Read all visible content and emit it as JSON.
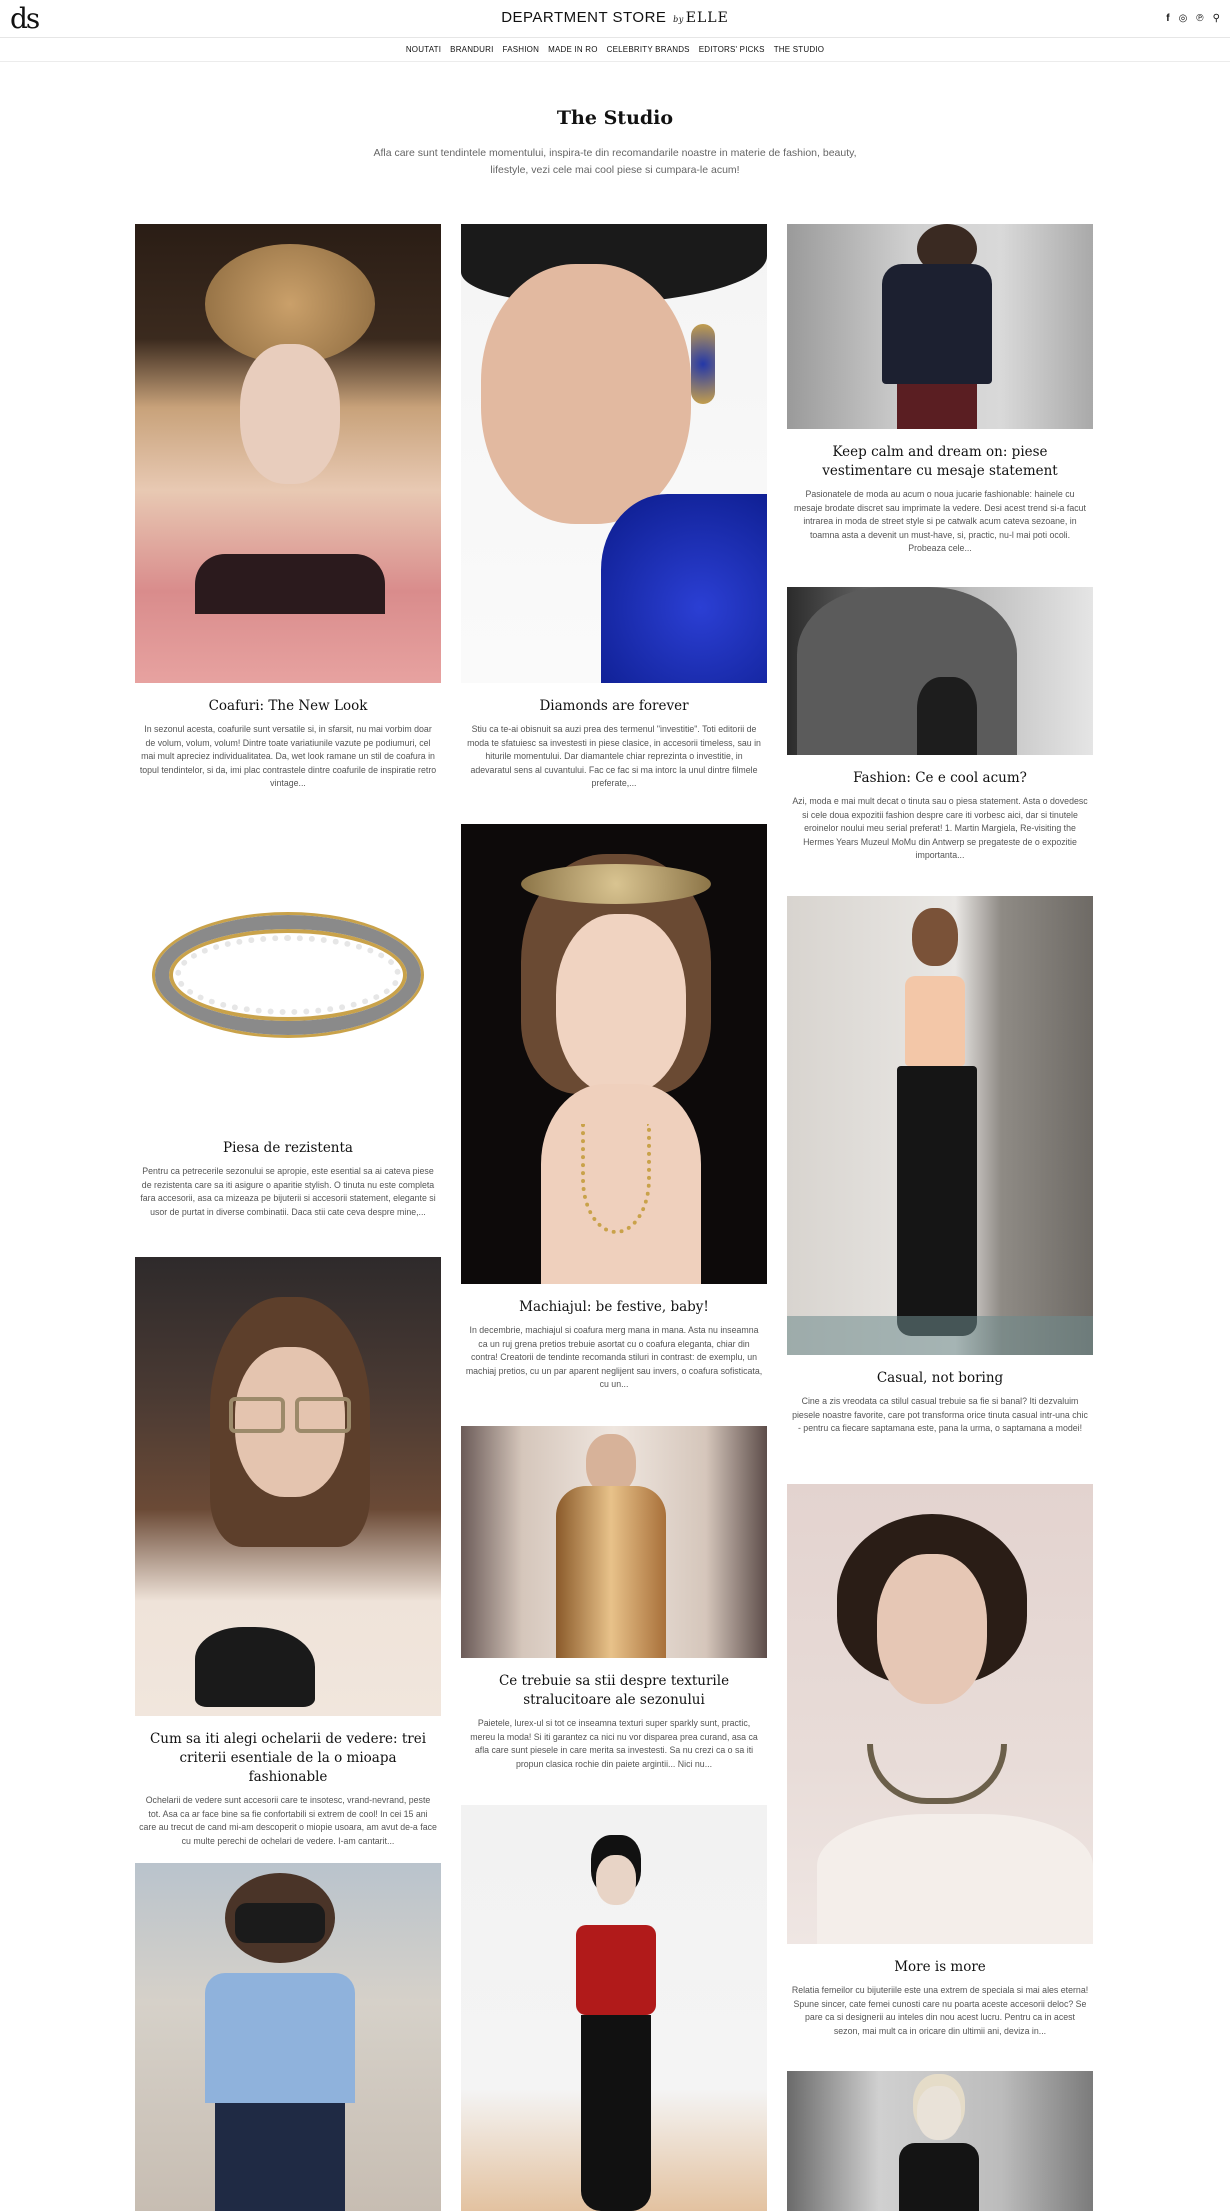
{
  "header": {
    "logo": "ds",
    "brand_name": "DEPARTMENT STORE",
    "brand_by": "by",
    "brand_elle": "ELLE",
    "social": [
      {
        "icon": "facebook-icon",
        "glyph": "f"
      },
      {
        "icon": "instagram-icon",
        "glyph": "◎"
      },
      {
        "icon": "pinterest-icon",
        "glyph": "℗"
      },
      {
        "icon": "search-icon",
        "glyph": "⚲"
      }
    ]
  },
  "nav": [
    "NOUTATI",
    "BRANDURI",
    "FASHION",
    "MADE IN RO",
    "CELEBRITY BRANDS",
    "EDITORS' PICKS",
    "THE STUDIO"
  ],
  "page": {
    "title": "The Studio",
    "intro": "Afla care sunt tendintele momentului, inspira-te din recomandarile noastre in materie de fashion, beauty, lifestyle, vezi cele mai cool piese si cumpara-le acum!"
  },
  "articles": [
    {
      "title": "Coafuri: The New Look",
      "excerpt": "In sezonul acesta, coafurile sunt versatile si, in sfarsit, nu mai vorbim doar de volum, volum, volum! Dintre toate variatiunile vazute pe podiumuri, cel mai mult apreciez individualitatea. Da, wet look ramane un stil de coafura in topul tendintelor, si da, imi plac contrastele dintre coafurile de inspiratie retro vintage..."
    },
    {
      "title": "Diamonds are forever",
      "excerpt": "Stiu ca te-ai obisnuit sa auzi prea des termenul \"investitie\". Toti editorii de moda te sfatuiesc sa investesti in piese clasice, in accesorii timeless, sau in hiturile momentului. Dar diamantele chiar reprezinta o investitie, in adevaratul sens al cuvantului. Fac ce fac si ma intorc la unul dintre filmele preferate,..."
    },
    {
      "title": "Keep calm and dream on: piese vestimentare cu mesaje statement",
      "excerpt": "Pasionatele de moda au acum o noua jucarie fashionable: hainele cu mesaje brodate discret sau imprimate la vedere. Desi acest trend si-a facut intrarea in moda de street style si pe catwalk acum cateva sezoane, in toamna asta a devenit un must-have, si, practic, nu-l mai poti ocoli. Probeaza cele..."
    },
    {
      "title": "Fashion: Ce e cool acum?",
      "excerpt": "Azi, moda e mai mult decat o tinuta sau o piesa statement. Asta o dovedesc si cele doua expozitii fashion despre care iti vorbesc aici, dar si tinutele eroinelor noului meu serial preferat! 1. Martin Margiela, Re-visiting the Hermes Years Muzeul MoMu din Antwerp se pregateste de o expozitie importanta..."
    },
    {
      "title": "Piesa de rezistenta",
      "excerpt": "Pentru ca petrecerile sezonului se apropie, este esential sa ai cateva piese de rezistenta care sa iti asigure o aparitie stylish. O tinuta nu este completa fara accesorii, asa ca mizeaza pe bijuterii si accesorii statement, elegante si usor de purtat in diverse combinatii. Daca stii cate ceva despre mine,..."
    },
    {
      "title": "Machiajul: be festive, baby!",
      "excerpt": "In decembrie, machiajul si coafura merg mana in mana. Asta nu inseamna ca un ruj grena pretios trebuie asortat cu o coafura eleganta, chiar din contra! Creatorii de tendinte recomanda stiluri in contrast: de exemplu, un machiaj pretios, cu un par aparent neglijent sau invers, o coafura sofisticata, cu un..."
    },
    {
      "title": "Casual, not boring",
      "excerpt": "Cine a zis vreodata ca stilul casual trebuie sa fie si banal? Iti dezvaluim piesele noastre favorite, care pot transforma orice tinuta casual intr-una chic - pentru ca fiecare saptamana este, pana la urma, o saptamana a modei!"
    },
    {
      "title": "Cum sa iti alegi ochelarii de vedere: trei criterii esentiale de la o mioapa fashionable",
      "excerpt": "Ochelarii de vedere sunt accesorii care te insotesc, vrand-nevrand, peste tot. Asa ca ar face bine sa fie confortabili si extrem de cool! In cei 15 ani care au trecut de cand mi-am descoperit o miopie usoara, am avut de-a face cu multe perechi de ochelari de vedere. I-am cantarit..."
    },
    {
      "title": "Ce trebuie sa stii despre texturile stralucitoare ale sezonului",
      "excerpt": "Paietele, lurex-ul si tot ce inseamna texturi super sparkly sunt, practic, mereu la moda! Si iti garantez ca nici nu vor disparea prea curand, asa ca afla care sunt piesele in care merita sa investesti. Sa nu crezi ca o sa iti propun clasica rochie din paiete argintii... Nici nu..."
    },
    {
      "title": "More is more",
      "excerpt": "Relatia femeilor cu bijuteriile este una extrem de speciala si mai ales eterna! Spune sincer, cate femei cunosti care nu poarta aceste accesorii deloc? Se pare ca si designerii au inteles din nou acest lucru. Pentru ca in acest sezon, mai mult ca in oricare din ultimii ani, deviza in..."
    }
  ],
  "image_labels": [
    "hair-model-photo",
    "jewelry-model-photo",
    "dream-on-jacket-photo",
    "back-portrait-photo",
    "bracelet-photo",
    "headband-model-photo",
    "casual-outfit-photo",
    "glasses-model-photo",
    "gold-coat-runway-photo",
    "necklace-model-photo",
    "street-style-photo",
    "red-top-runway-photo",
    "lace-dress-runway-photo"
  ]
}
